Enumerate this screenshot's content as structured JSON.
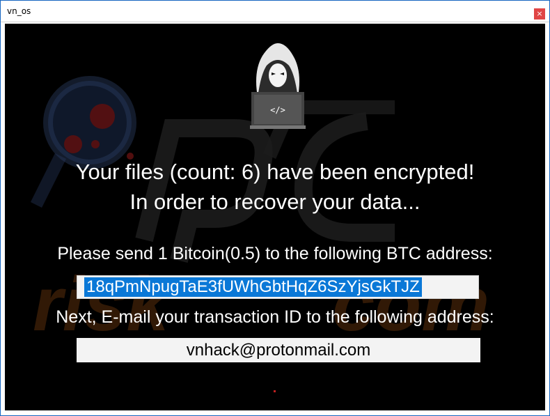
{
  "window": {
    "title": "vn_os",
    "close_glyph": "×"
  },
  "icons": {
    "close": "close-icon",
    "hacker": "hooded-hacker-laptop-icon"
  },
  "laptop_code": "</>",
  "message": {
    "line1": "Your files (count: 6) have been encrypted!",
    "line2": "In order to recover your data...",
    "line3": "Please send 1 Bitcoin(0.5) to the following BTC address:",
    "line4": "Next, E-mail your transaction ID to the following address:"
  },
  "btc_address": "18qPmNpugTaE3fUWhGbtHqZ6SzYjsGkTJZ",
  "email": "vnhack@protonmail.com",
  "colors": {
    "background": "#000000",
    "text": "#ffffff",
    "selection": "#0a78d7",
    "field": "#f3f3f3",
    "close_button": "#e04545",
    "window_border": "#1565c0"
  }
}
